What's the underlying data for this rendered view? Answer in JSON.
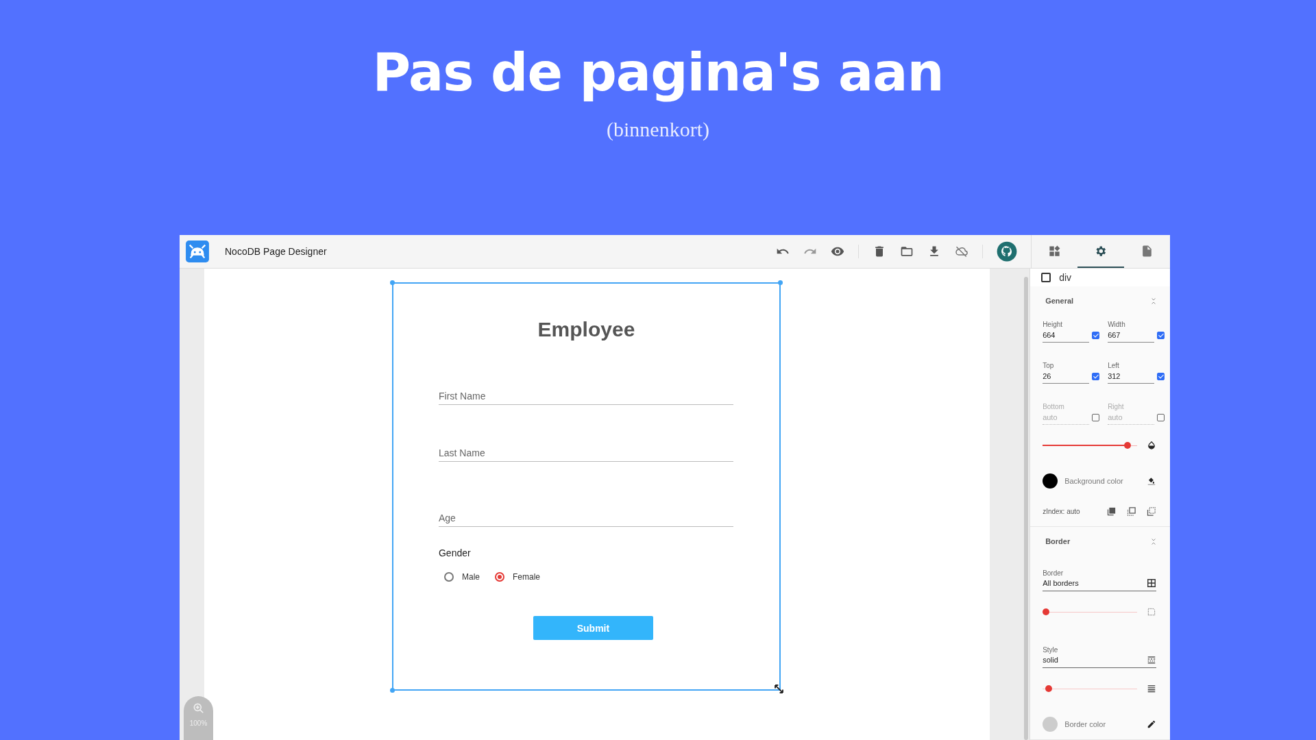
{
  "hero": {
    "title": "Pas de pagina's aan",
    "subtitle": "(binnenkort)"
  },
  "app": {
    "title": "NocoDB Page Designer"
  },
  "panel_tabs": [
    {
      "kind": "blocks",
      "selected": false
    },
    {
      "kind": "settings",
      "selected": true
    },
    {
      "kind": "page",
      "selected": false
    }
  ],
  "form": {
    "title": "Employee",
    "fields": [
      {
        "placeholder": "First Name"
      },
      {
        "placeholder": "Last Name"
      },
      {
        "placeholder": "Age"
      }
    ],
    "gender_label": "Gender",
    "options": [
      {
        "label": "Male",
        "selected": false
      },
      {
        "label": "Female",
        "selected": true
      }
    ],
    "submit": "Submit"
  },
  "zoom": "100%",
  "panel": {
    "element": {
      "label": "div",
      "checked": false
    },
    "general_title": "General",
    "position_fields": [
      {
        "label": "Height",
        "value": "664",
        "checked": true
      },
      {
        "label": "Width",
        "value": "667",
        "checked": true
      },
      {
        "label": "Top",
        "value": "26",
        "checked": true
      },
      {
        "label": "Left",
        "value": "312",
        "checked": true
      },
      {
        "label": "Bottom",
        "placeholder": "auto",
        "checked": false
      },
      {
        "label": "Right",
        "placeholder": "auto",
        "checked": false
      }
    ],
    "opacity": {
      "level": 0.93
    },
    "background": {
      "label": "Background color",
      "color": "#000000"
    },
    "zindex": "zIndex: auto",
    "border_title": "Border",
    "border": {
      "label": "Border",
      "value": "All borders"
    },
    "radius": {
      "level": 0
    },
    "style": {
      "label": "Style",
      "value": "solid"
    },
    "border_width": {
      "level": 0.03
    },
    "border_color": {
      "label": "Border color",
      "color": "#cccccc"
    }
  }
}
